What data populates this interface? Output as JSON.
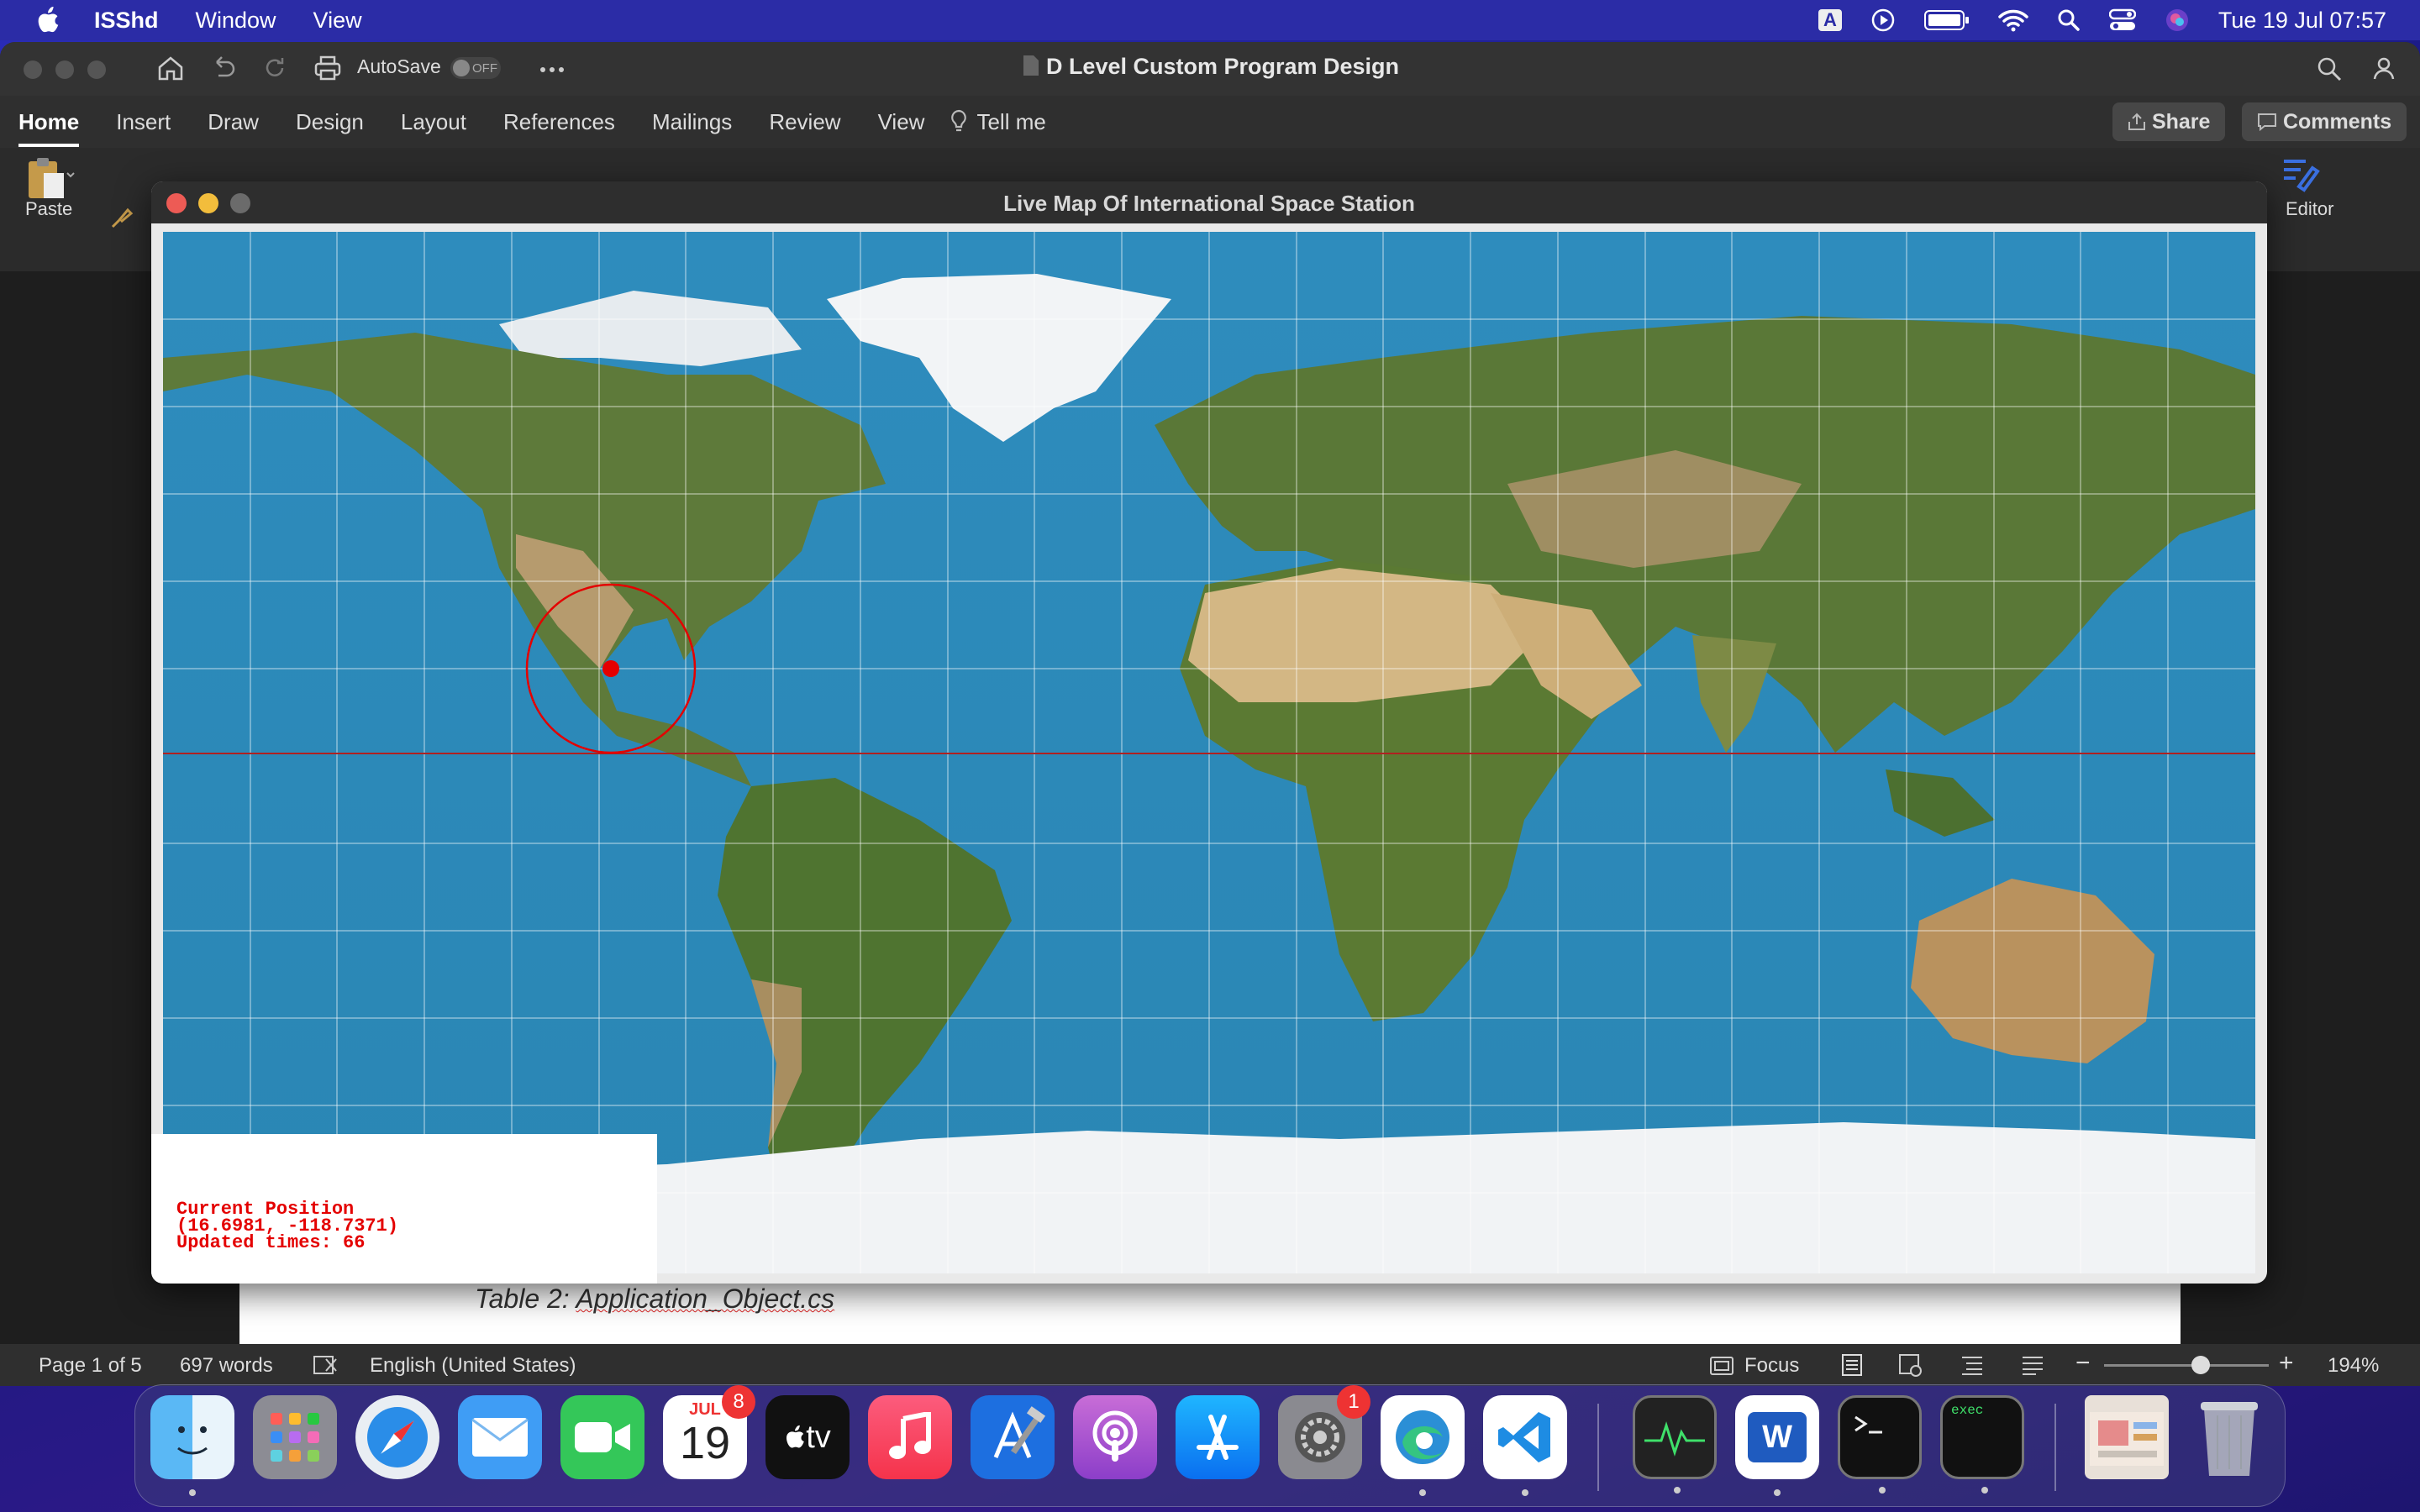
{
  "menubar": {
    "app_name": "ISShd",
    "items": [
      "Window",
      "View"
    ],
    "input_badge": "A",
    "datetime": "Tue 19 Jul  07:57"
  },
  "word": {
    "doc_title": "D Level Custom Program Design",
    "autosave_label": "AutoSave",
    "autosave_state": "OFF",
    "tabs": [
      "Home",
      "Insert",
      "Draw",
      "Design",
      "Layout",
      "References",
      "Mailings",
      "Review",
      "View"
    ],
    "tell_me": "Tell me",
    "share_label": "Share",
    "comments_label": "Comments",
    "paste_label": "Paste",
    "editor_label": "Editor",
    "caption_prefix": "Table 2: ",
    "caption_file": "Application_Object.cs",
    "status": {
      "page": "Page 1 of 5",
      "words": "697 words",
      "language": "English (United States)",
      "focus": "Focus",
      "zoom": "194%"
    }
  },
  "map_window": {
    "title": "Live Map Of International Space Station",
    "info_lines": [
      "Current Position",
      "(16.6981, -118.7371)",
      "Updated times: 66"
    ],
    "iss_marker_color": "#e40000"
  },
  "dock": {
    "apps": [
      "Finder",
      "Launchpad",
      "Safari",
      "Mail",
      "FaceTime",
      "Calendar",
      "Apple TV",
      "Music",
      "Xcode",
      "Podcasts",
      "App Store",
      "System Preferences",
      "Microsoft Edge",
      "Visual Studio Code",
      "Activity Monitor",
      "Microsoft Word",
      "Terminal",
      "exec",
      "Downloads",
      "Trash"
    ],
    "calendar_month": "JUL",
    "calendar_day": "19",
    "calendar_badge": "8",
    "settings_badge": "1",
    "exec_label": "exec",
    "tv_label": "tv",
    "word_letter": "W"
  }
}
